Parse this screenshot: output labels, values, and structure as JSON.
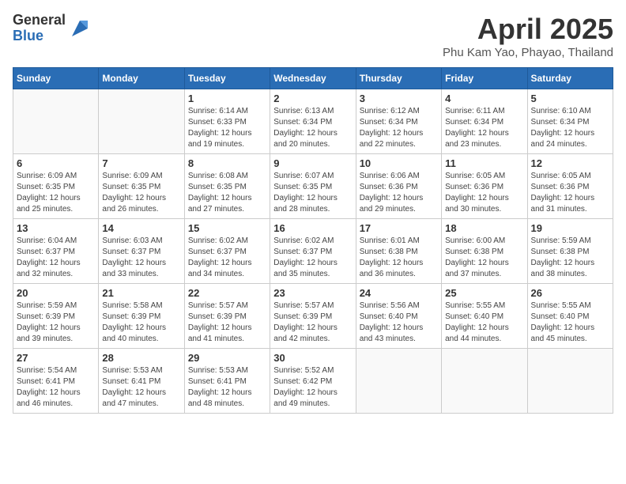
{
  "header": {
    "logo_general": "General",
    "logo_blue": "Blue",
    "title": "April 2025",
    "location": "Phu Kam Yao, Phayao, Thailand"
  },
  "days_of_week": [
    "Sunday",
    "Monday",
    "Tuesday",
    "Wednesday",
    "Thursday",
    "Friday",
    "Saturday"
  ],
  "weeks": [
    [
      {
        "day": "",
        "detail": ""
      },
      {
        "day": "",
        "detail": ""
      },
      {
        "day": "1",
        "detail": "Sunrise: 6:14 AM\nSunset: 6:33 PM\nDaylight: 12 hours and 19 minutes."
      },
      {
        "day": "2",
        "detail": "Sunrise: 6:13 AM\nSunset: 6:34 PM\nDaylight: 12 hours and 20 minutes."
      },
      {
        "day": "3",
        "detail": "Sunrise: 6:12 AM\nSunset: 6:34 PM\nDaylight: 12 hours and 22 minutes."
      },
      {
        "day": "4",
        "detail": "Sunrise: 6:11 AM\nSunset: 6:34 PM\nDaylight: 12 hours and 23 minutes."
      },
      {
        "day": "5",
        "detail": "Sunrise: 6:10 AM\nSunset: 6:34 PM\nDaylight: 12 hours and 24 minutes."
      }
    ],
    [
      {
        "day": "6",
        "detail": "Sunrise: 6:09 AM\nSunset: 6:35 PM\nDaylight: 12 hours and 25 minutes."
      },
      {
        "day": "7",
        "detail": "Sunrise: 6:09 AM\nSunset: 6:35 PM\nDaylight: 12 hours and 26 minutes."
      },
      {
        "day": "8",
        "detail": "Sunrise: 6:08 AM\nSunset: 6:35 PM\nDaylight: 12 hours and 27 minutes."
      },
      {
        "day": "9",
        "detail": "Sunrise: 6:07 AM\nSunset: 6:35 PM\nDaylight: 12 hours and 28 minutes."
      },
      {
        "day": "10",
        "detail": "Sunrise: 6:06 AM\nSunset: 6:36 PM\nDaylight: 12 hours and 29 minutes."
      },
      {
        "day": "11",
        "detail": "Sunrise: 6:05 AM\nSunset: 6:36 PM\nDaylight: 12 hours and 30 minutes."
      },
      {
        "day": "12",
        "detail": "Sunrise: 6:05 AM\nSunset: 6:36 PM\nDaylight: 12 hours and 31 minutes."
      }
    ],
    [
      {
        "day": "13",
        "detail": "Sunrise: 6:04 AM\nSunset: 6:37 PM\nDaylight: 12 hours and 32 minutes."
      },
      {
        "day": "14",
        "detail": "Sunrise: 6:03 AM\nSunset: 6:37 PM\nDaylight: 12 hours and 33 minutes."
      },
      {
        "day": "15",
        "detail": "Sunrise: 6:02 AM\nSunset: 6:37 PM\nDaylight: 12 hours and 34 minutes."
      },
      {
        "day": "16",
        "detail": "Sunrise: 6:02 AM\nSunset: 6:37 PM\nDaylight: 12 hours and 35 minutes."
      },
      {
        "day": "17",
        "detail": "Sunrise: 6:01 AM\nSunset: 6:38 PM\nDaylight: 12 hours and 36 minutes."
      },
      {
        "day": "18",
        "detail": "Sunrise: 6:00 AM\nSunset: 6:38 PM\nDaylight: 12 hours and 37 minutes."
      },
      {
        "day": "19",
        "detail": "Sunrise: 5:59 AM\nSunset: 6:38 PM\nDaylight: 12 hours and 38 minutes."
      }
    ],
    [
      {
        "day": "20",
        "detail": "Sunrise: 5:59 AM\nSunset: 6:39 PM\nDaylight: 12 hours and 39 minutes."
      },
      {
        "day": "21",
        "detail": "Sunrise: 5:58 AM\nSunset: 6:39 PM\nDaylight: 12 hours and 40 minutes."
      },
      {
        "day": "22",
        "detail": "Sunrise: 5:57 AM\nSunset: 6:39 PM\nDaylight: 12 hours and 41 minutes."
      },
      {
        "day": "23",
        "detail": "Sunrise: 5:57 AM\nSunset: 6:39 PM\nDaylight: 12 hours and 42 minutes."
      },
      {
        "day": "24",
        "detail": "Sunrise: 5:56 AM\nSunset: 6:40 PM\nDaylight: 12 hours and 43 minutes."
      },
      {
        "day": "25",
        "detail": "Sunrise: 5:55 AM\nSunset: 6:40 PM\nDaylight: 12 hours and 44 minutes."
      },
      {
        "day": "26",
        "detail": "Sunrise: 5:55 AM\nSunset: 6:40 PM\nDaylight: 12 hours and 45 minutes."
      }
    ],
    [
      {
        "day": "27",
        "detail": "Sunrise: 5:54 AM\nSunset: 6:41 PM\nDaylight: 12 hours and 46 minutes."
      },
      {
        "day": "28",
        "detail": "Sunrise: 5:53 AM\nSunset: 6:41 PM\nDaylight: 12 hours and 47 minutes."
      },
      {
        "day": "29",
        "detail": "Sunrise: 5:53 AM\nSunset: 6:41 PM\nDaylight: 12 hours and 48 minutes."
      },
      {
        "day": "30",
        "detail": "Sunrise: 5:52 AM\nSunset: 6:42 PM\nDaylight: 12 hours and 49 minutes."
      },
      {
        "day": "",
        "detail": ""
      },
      {
        "day": "",
        "detail": ""
      },
      {
        "day": "",
        "detail": ""
      }
    ]
  ]
}
